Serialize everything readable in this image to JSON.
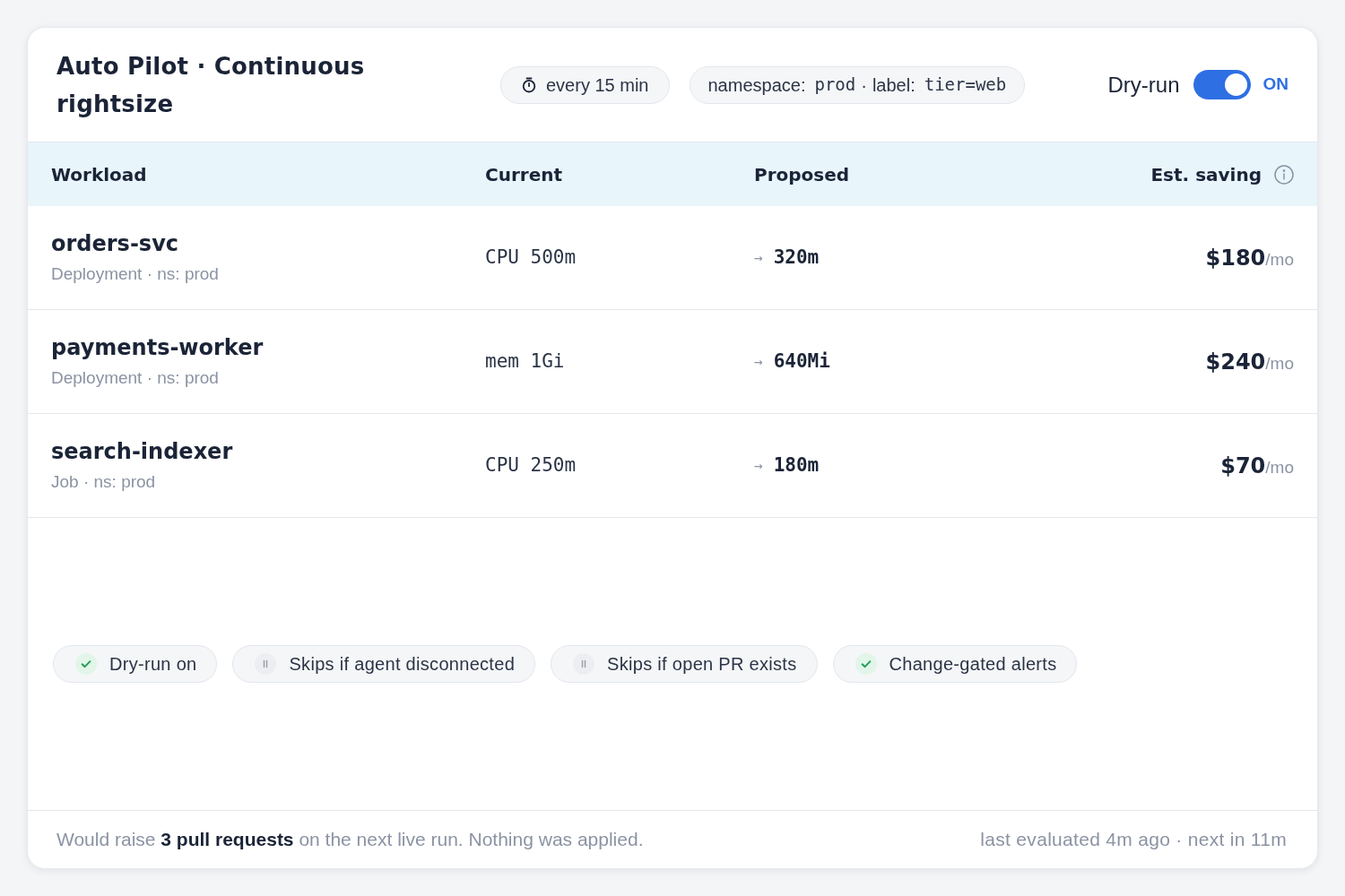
{
  "header": {
    "title": "Auto Pilot · Continuous rightsize",
    "schedule": "every 15 min",
    "filter": {
      "parts": [
        {
          "key": "namespace:",
          "value": "prod"
        },
        {
          "key": "label:",
          "value": "tier=web"
        }
      ],
      "separator": "·"
    },
    "dry_run": {
      "label": "Dry-run",
      "on": true,
      "state_text": "ON"
    }
  },
  "table": {
    "columns": [
      "Workload",
      "Current",
      "Proposed",
      "Est. saving"
    ],
    "rows": [
      {
        "name": "orders-svc",
        "meta": "Deployment · ns: prod",
        "current": "CPU 500m",
        "arrow": "→",
        "proposed": "320m",
        "saving": "$180",
        "unit": "/mo"
      },
      {
        "name": "payments-worker",
        "meta": "Deployment · ns: prod",
        "current": "mem 1Gi",
        "arrow": "→",
        "proposed": "640Mi",
        "saving": "$240",
        "unit": "/mo"
      },
      {
        "name": "search-indexer",
        "meta": "Job · ns: prod",
        "current": "CPU 250m",
        "arrow": "→",
        "proposed": "180m",
        "saving": "$70",
        "unit": "/mo"
      }
    ]
  },
  "policies": [
    {
      "kind": "check",
      "label": "Dry-run on"
    },
    {
      "kind": "pause",
      "label": "Skips if agent disconnected"
    },
    {
      "kind": "pause",
      "label": "Skips if open PR exists"
    },
    {
      "kind": "check",
      "label": "Change-gated alerts"
    }
  ],
  "status_bar": {
    "summary": "Would raise **3 pull requests** on the next live run. Nothing was applied.",
    "evaluation": "last evaluated 4m ago · next in 11m"
  }
}
